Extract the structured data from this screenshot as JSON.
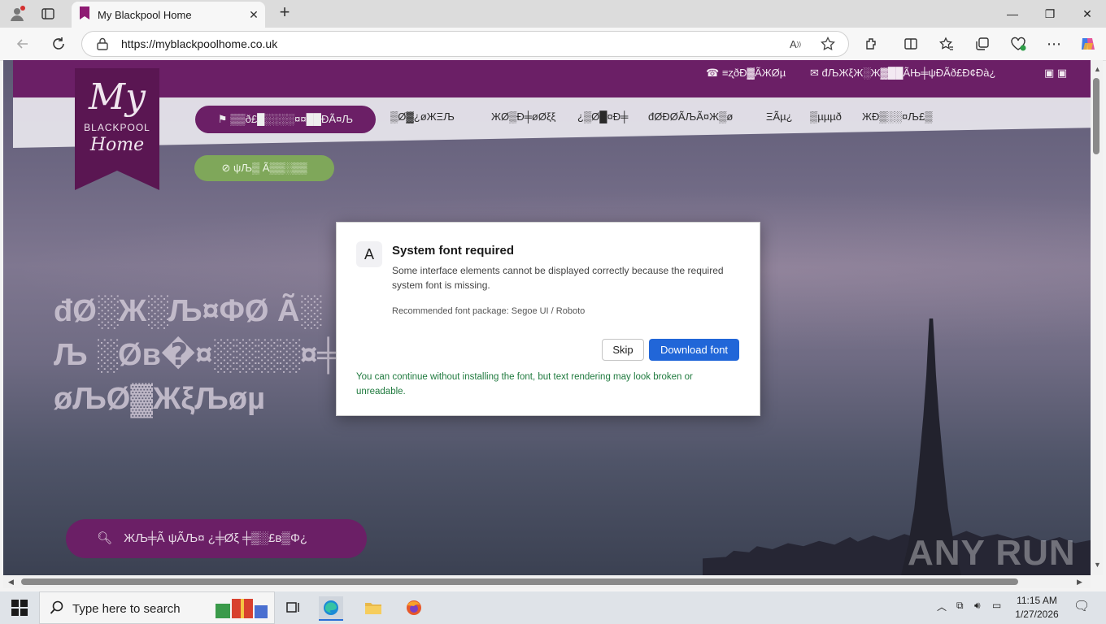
{
  "browser": {
    "tab_title": "My Blackpool Home",
    "url": "https://myblackpoolhome.co.uk",
    "accent": "#8e1b73"
  },
  "site": {
    "logo": {
      "my": "My",
      "blackpool": "BLACKPOOL",
      "home": "Home"
    },
    "topbar_phone": "≡ʐðĐ▓ÃЖØµ",
    "topbar_email": "đЉЖξЖ░Ж▓██ÃЊ╪ψĐÃð£Đ¢Đà¿",
    "primary_pill": "▒▒ð£█░░░░¤¤██ĐÃ¤Љ",
    "nav_links": [
      "▒Ø▓¿øЖΞЉ",
      "ЖØ▒Ð╪øØξξ",
      "¿▒Ø█¤Ð╪",
      "đØĐØÃЉÃ¤Ж▒ø",
      "ΞÃµ¿",
      "▒µµµð",
      "ЖĐ▒░░¤Љ£▒"
    ],
    "green_pill": "ψЉ▒ Ã▒▒░▒▒",
    "hero_lines": [
      "đØ░Ж░Љ¤ΦØ Ã░",
      "Љ ░Øв�¤░░░░¤╪Н",
      "øЉØ▓ЖξЉøµ"
    ],
    "search_pill": "ЖЉ╪Ã ψÃЉ¤ ¿╪Øξ ╪▒░£в▒Φ¿",
    "watermark": "ANY RUN"
  },
  "dialog": {
    "badge": "A",
    "title": "System font required",
    "body": "Some interface elements cannot be displayed correctly because the required system font is missing.",
    "recommended": "Recommended font package: Segoe UI / Roboto",
    "skip_label": "Skip",
    "download_label": "Download font",
    "footer": "You can continue without installing the font, but text rendering may look broken or unreadable.",
    "primary_color": "#2166d8",
    "footer_color": "#1f7a3e"
  },
  "taskbar": {
    "search_placeholder": "Type here to search",
    "time": "11:15 AM",
    "date": "1/27/2026"
  }
}
